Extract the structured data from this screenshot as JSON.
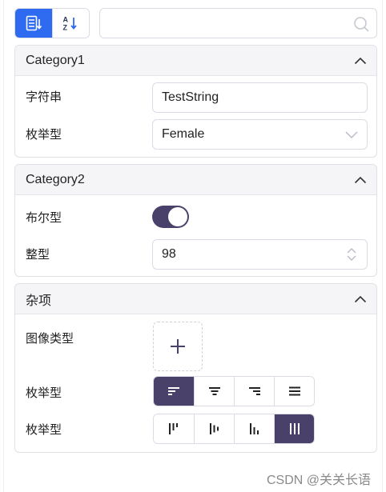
{
  "toolbar": {
    "sort_category_icon": "categorized-sort-icon",
    "sort_alpha_icon": "alphabetical-sort-icon",
    "search": {
      "value": "",
      "placeholder": "",
      "icon": "search-icon"
    }
  },
  "categories": [
    {
      "title": "Category1",
      "rows": [
        {
          "label": "字符串",
          "value": "TestString"
        },
        {
          "label": "枚举型",
          "value": "Female"
        }
      ]
    },
    {
      "title": "Category2",
      "rows": [
        {
          "label": "布尔型",
          "value": true
        },
        {
          "label": "整型",
          "value": "98"
        }
      ]
    },
    {
      "title": "杂项",
      "rows": [
        {
          "label": "图像类型"
        },
        {
          "label": "枚举型",
          "options": [
            "align-left",
            "align-center",
            "align-right",
            "align-justify"
          ],
          "selected": 0
        },
        {
          "label": "枚举型",
          "options": [
            "align-top",
            "align-middle",
            "align-bottom",
            "align-stretch"
          ],
          "selected": 3
        }
      ]
    }
  ],
  "colors": {
    "accent_blue": "#2f6bf0",
    "accent_purple": "#4a416b",
    "border": "#d9dce4"
  },
  "watermark": "CSDN @关关长语"
}
